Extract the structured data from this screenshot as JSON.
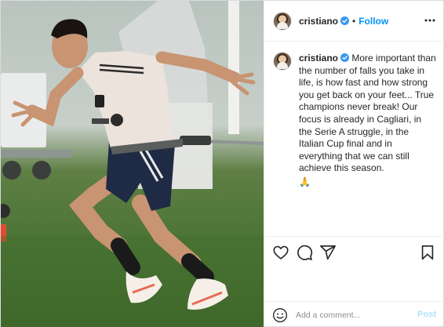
{
  "post": {
    "photo": {
      "alt_icon": "soccer-player-training-photo"
    },
    "header": {
      "username": "cristiano",
      "verified_icon": "verified-badge-icon",
      "separator": "•",
      "follow_label": "Follow",
      "more_icon": "more-options-icon"
    },
    "caption": {
      "username": "cristiano",
      "text": "More important than the number of falls you take in life, is how fast and how strong you get back on your feet... True champions never break! Our focus is already in Cagliari, in the Serie A struggle, in the Italian Cup final and in everything that we can still achieve this season.",
      "emoji": "🙏"
    },
    "actions": {
      "like_icon": "heart-icon",
      "comment_icon": "comment-icon",
      "share_icon": "share-icon",
      "save_icon": "bookmark-icon"
    },
    "comment_box": {
      "emoji_icon": "smiley-icon",
      "placeholder": "Add a comment...",
      "post_label": "Post"
    },
    "colors": {
      "accent": "#0095f6",
      "post_disabled": "#b2dffc",
      "verified": "#3897f0",
      "border": "#dbdbdb"
    }
  }
}
